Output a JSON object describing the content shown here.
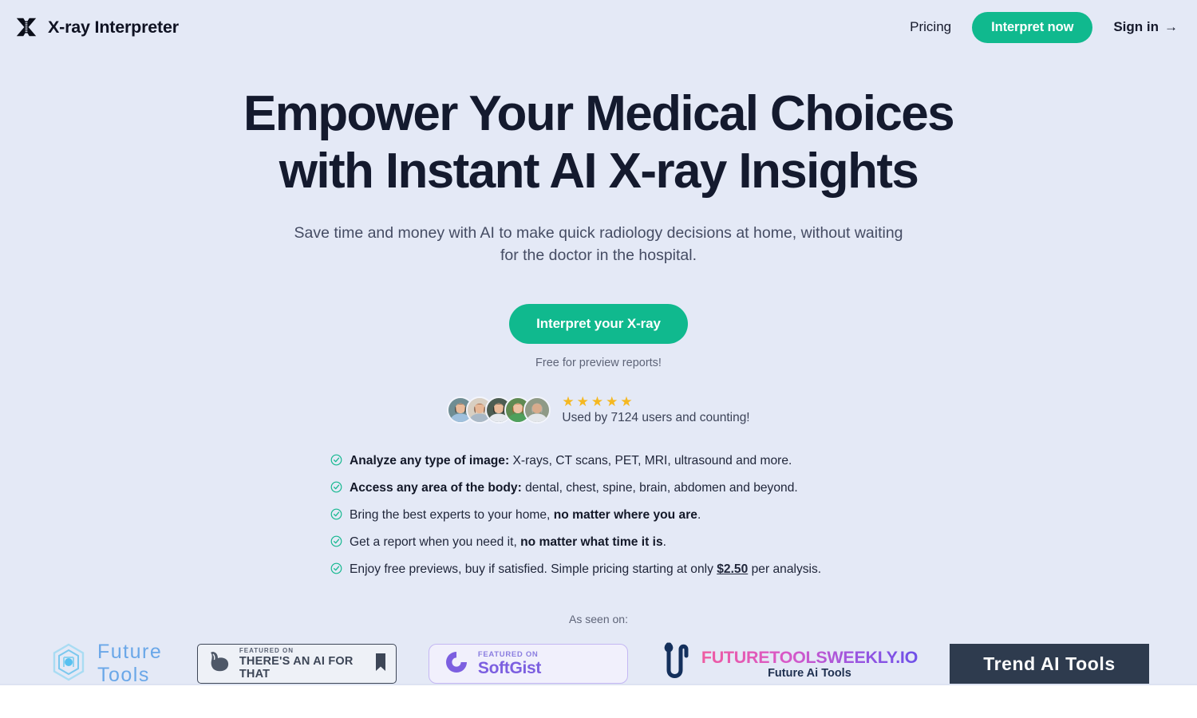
{
  "header": {
    "logo_icon": "xray-x-logo-icon",
    "brand": "X-ray Interpreter",
    "nav": {
      "pricing": "Pricing",
      "interpret_now": "Interpret now",
      "signin": "Sign in",
      "signin_arrow": "→"
    }
  },
  "hero": {
    "headline_line1": "Empower Your Medical Choices",
    "headline_line2": "with Instant AI X-ray Insights",
    "subhead": "Save time and money with AI to make quick radiology decisions at home, without waiting for the doctor in the hospital.",
    "cta_label": "Interpret your X-ray",
    "cta_note": "Free for preview reports!"
  },
  "social_proof": {
    "star_glyph": "★",
    "star_count": 5,
    "caption": "Used by 7124 users and counting!",
    "avatar_count": 5,
    "avatars": [
      {
        "name": "avatar-user-1",
        "bg": "#6f8d93",
        "skin": "#e8bb9b",
        "hair": "#3a2a20",
        "shirt": "#9fc0dd"
      },
      {
        "name": "avatar-user-2",
        "bg": "#d8cfc2",
        "skin": "#e7b897",
        "hair": "#5a3320",
        "shirt": "#a9b8c6"
      },
      {
        "name": "avatar-user-3",
        "bg": "#4d5d52",
        "skin": "#e9bb9a",
        "hair": "#221913",
        "shirt": "#e6e9ee"
      },
      {
        "name": "avatar-user-4",
        "bg": "#5f8a52",
        "skin": "#ecc2a3",
        "hair": "#b4551f",
        "shirt": "#4fa05c"
      },
      {
        "name": "avatar-user-5",
        "bg": "#8f9a86",
        "skin": "#d8ab8b",
        "hair": "#b9b5b0",
        "shirt": "#e3e6ea"
      }
    ]
  },
  "features": [
    {
      "bold_lead": "Analyze any type of image:",
      "rest": " X-rays, CT scans, PET, MRI, ultrasound and more."
    },
    {
      "bold_lead": "Access any area of the body:",
      "rest": " dental, chest, spine, brain, abdomen and beyond."
    },
    {
      "lead": "Bring the best experts to your home, ",
      "bold_mid": "no matter where you are",
      "tail": "."
    },
    {
      "lead": "Get a report when you need it, ",
      "bold_mid": "no matter what time it is",
      "tail": "."
    },
    {
      "lead": "Enjoy free previews, buy if satisfied. Simple pricing starting at only ",
      "underline_mid": "$2.50",
      "tail": " per analysis."
    }
  ],
  "as_seen_on": {
    "label": "As seen on:",
    "logos": {
      "future_tools": {
        "name": "Future Tools"
      },
      "theres_an_ai_for_that": {
        "small": "FEATURED ON",
        "big": "THERE'S AN AI FOR THAT"
      },
      "softgist": {
        "small": "FEATURED ON",
        "big": "SoftGist"
      },
      "futuretoolsweekly": {
        "big": "FUTURETOOLSWEEKLY.IO",
        "sub": "Future Ai Tools"
      },
      "trend_ai_tools": {
        "big": "Trend AI Tools"
      }
    }
  },
  "colors": {
    "background": "#e4e9f6",
    "accent_green": "#10b98e",
    "headline": "#141a2e",
    "star_gold": "#f5b821"
  }
}
